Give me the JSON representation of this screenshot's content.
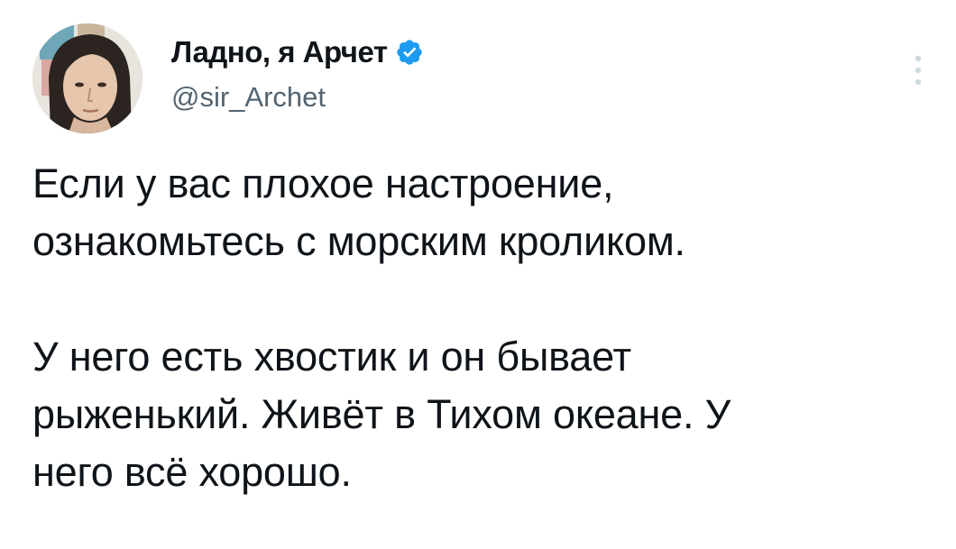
{
  "author": {
    "display_name": "Ладно, я Арчет",
    "handle": "@sir_Archet",
    "verified": true
  },
  "icons": {
    "verified": "verified-badge-icon",
    "more": "more-vertical-icon"
  },
  "colors": {
    "verified_blue": "#1d9bf0",
    "text": "#0f1419",
    "secondary": "#536471"
  },
  "tweet": {
    "paragraphs": [
      "Если у вас плохое настроение,\nознакомьтесь с морским кроликом.",
      "У него есть хвостик и он бывает\nрыженький. Живёт в Тихом океане. У\nнего всё хорошо."
    ]
  }
}
